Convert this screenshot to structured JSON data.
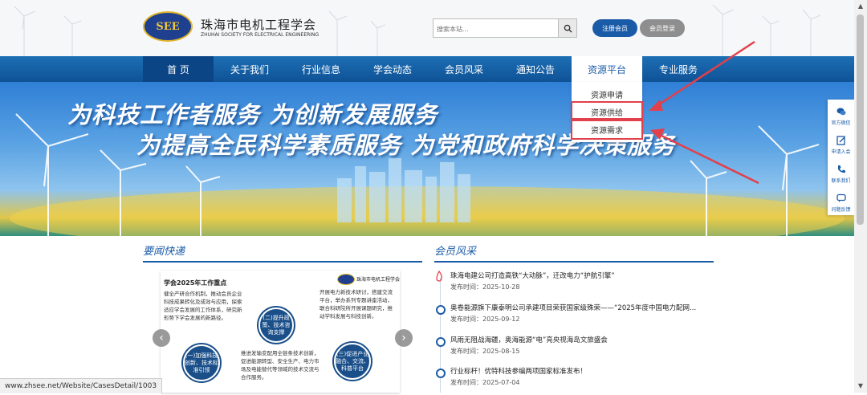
{
  "header": {
    "logo_text": "SEE",
    "site_name": "珠海市电机工程学会",
    "site_name_en": "ZHUHAI SOCIETY FOR ELECTRICAL ENGINEERING",
    "search_placeholder": "搜索本站...",
    "register_label": "注册会员",
    "login_label": "会员登录"
  },
  "nav": {
    "items": [
      "首 页",
      "关于我们",
      "行业信息",
      "学会动态",
      "会员风采",
      "通知公告",
      "资源平台",
      "专业服务"
    ],
    "dropdown": [
      "资源申请",
      "资源供给",
      "资源需求"
    ]
  },
  "banner": {
    "line1": "为科技工作者服务 为创新发展服务",
    "line2": "为提高全民科学素质服务 为党和政府科学决策服务"
  },
  "sidebar": [
    "官方微信",
    "申请入会",
    "联系我们",
    "问题反馈"
  ],
  "news": {
    "title": "要闻快递",
    "card_heading": "学会2025年工作重点",
    "card_org": "珠海市电机工程学会",
    "card_left_text": "健全产研合作机制，推动会员企业科技成果转化及成效与应用，探索适应学会发展的工作体系，研究新形势下学会发展的新路径。",
    "card_right_text": "开展电力新技术研讨，搭建交流平台，举办系列专题讲座活动，联合科研院所开展课题研究，推动学科发展与科技创新。",
    "card_bottom_text": "推进发输变配用全链条技术创新，促进能源转型、安全生产、电力市场及电能替代等领域的技术交流与合作服务。",
    "bubble1": "(二)提升政策、技术咨询支撑",
    "bubble2": "(一)加强科技创新、技术标准引领",
    "bubble3": "(三)促进产业融合、交流、科普平台",
    "prev": "‹",
    "next": "›"
  },
  "members": {
    "title": "会员风采",
    "items": [
      {
        "title": "珠海电建公司打造高铁“大动脉”，迁改电力“护航引擎”",
        "date": "发布时间：2025-10-28"
      },
      {
        "title": "奥卷能源旗下康泰明公司承建项目荣获国家级殊荣——“2025年度中国电力配网...",
        "date": "发布时间：2025-09-12"
      },
      {
        "title": "风雨无阻战海疆，奥海能源“电”亮央视海岛文旅盛会",
        "date": "发布时间：2025-08-15"
      },
      {
        "title": "行业标杆！优特科技参编两项国家标准发布！",
        "date": "发布时间：2025-07-04"
      }
    ]
  },
  "status_url": "www.zhsee.net/Website/CasesDetail/1003",
  "colors": {
    "brand": "#1a5ba8",
    "highlight": "#e2404a",
    "nav_active": "#0b4586"
  }
}
